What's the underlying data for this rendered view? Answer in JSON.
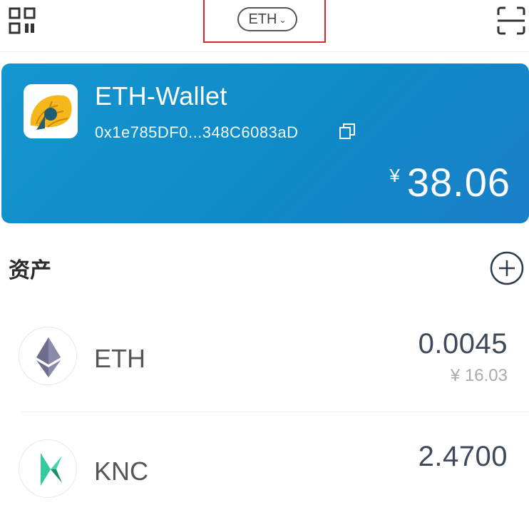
{
  "header": {
    "chain_selector": "ETH",
    "chain_chevron": "⌄",
    "icons": {
      "left": "qr-code-icon",
      "right": "scan-icon"
    }
  },
  "wallet": {
    "name": "ETH-Wallet",
    "address": "0x1e785DF0...348C6083aD",
    "currency_symbol": "¥",
    "balance": "38.06",
    "card_color": "#1290cc"
  },
  "assets": {
    "title": "资产",
    "items": [
      {
        "symbol": "ETH",
        "amount": "0.0045",
        "value": "¥ 16.03",
        "icon": "ethereum-icon"
      },
      {
        "symbol": "KNC",
        "amount": "2.4700",
        "icon": "kyber-network-icon"
      }
    ]
  }
}
